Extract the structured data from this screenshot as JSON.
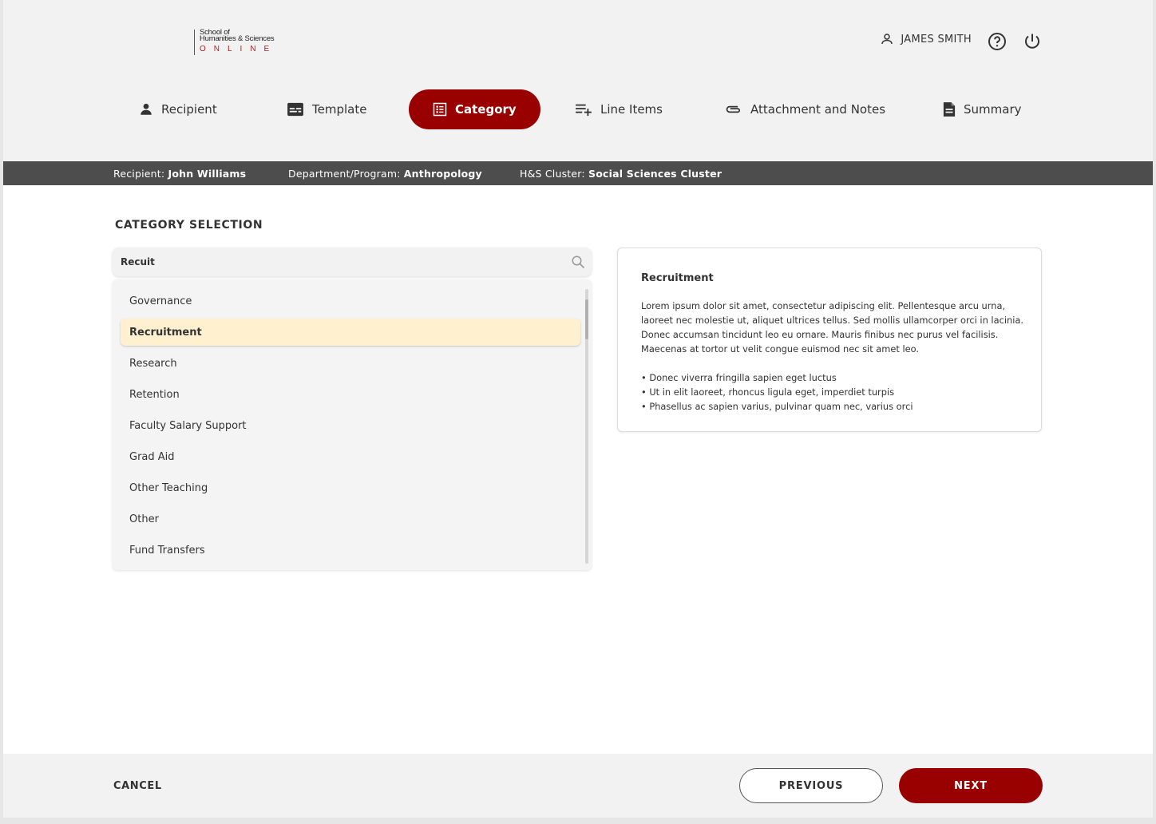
{
  "logo": {
    "line1": "School of",
    "line2": "Humanities & Sciences",
    "line3": "ONLINE"
  },
  "user": {
    "name": "JAMES SMITH",
    "icon": "user-icon"
  },
  "header_icons": [
    "help-icon",
    "power-icon"
  ],
  "steps": [
    {
      "label": "Recipient",
      "icon": "person-icon",
      "active": false
    },
    {
      "label": "Template",
      "icon": "template-icon",
      "active": false
    },
    {
      "label": "Category",
      "icon": "category-list-icon",
      "active": true
    },
    {
      "label": "Line Items",
      "icon": "playlist-add-icon",
      "active": false
    },
    {
      "label": "Attachment and Notes",
      "icon": "paperclip-icon",
      "active": false
    },
    {
      "label": "Summary",
      "icon": "document-icon",
      "active": false
    }
  ],
  "infobar": {
    "recipient_label": "Recipient:",
    "recipient_value": "John Williams",
    "department_label": "Department/Program:",
    "department_value": "Anthropology",
    "cluster_label": "H&S Cluster:",
    "cluster_value": "Social Sciences Cluster"
  },
  "main": {
    "section_title": "CATEGORY SELECTION",
    "search_value": "Recuit",
    "categories": [
      {
        "label": "Governance",
        "selected": false
      },
      {
        "label": "Recruitment",
        "selected": true
      },
      {
        "label": "Research",
        "selected": false
      },
      {
        "label": "Retention",
        "selected": false
      },
      {
        "label": "Faculty Salary Support",
        "selected": false
      },
      {
        "label": "Grad Aid",
        "selected": false
      },
      {
        "label": "Other Teaching",
        "selected": false
      },
      {
        "label": "Other",
        "selected": false
      },
      {
        "label": "Fund Transfers",
        "selected": false
      }
    ],
    "description": {
      "title": "Recruitment",
      "body": "Lorem ipsum dolor sit amet, consectetur adipiscing elit. Pellentesque arcu urna, laoreet nec molestie ut, aliquet ultrices tellus. Sed mollis ullamcorper orci in lacinia. Donec accumsan tincidunt leo eu ornare. Mauris finibus nec purus vel facilisis. Maecenas at tortor ut velit congue euismod nec sit amet leo.",
      "bullets": [
        "• Donec viverra fringilla sapien eget luctus",
        "• Ut in elit laoreet, rhoncus ligula eget, imperdiet turpis",
        "• Phasellus ac sapien varius, pulvinar quam nec, varius orci"
      ]
    }
  },
  "footer": {
    "cancel_label": "CANCEL",
    "previous_label": "PREVIOUS",
    "next_label": "NEXT"
  },
  "colors": {
    "accent": "#990000",
    "selected_bg": "#fff1d0",
    "infobar_bg": "#4d4d4d",
    "logo_red": "#b01c1c"
  }
}
